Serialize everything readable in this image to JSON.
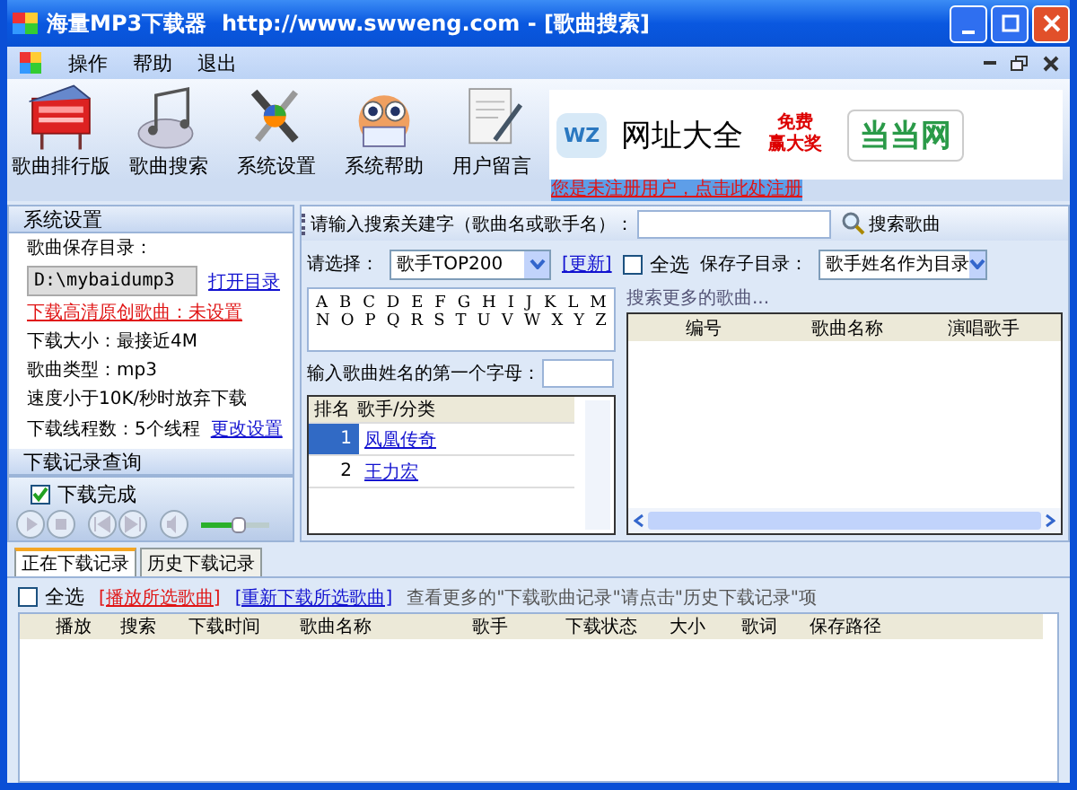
{
  "window": {
    "title": "海量MP3下载器  http://www.swweng.com - [歌曲搜索]"
  },
  "menu": {
    "items": [
      "操作",
      "帮助",
      "退出"
    ]
  },
  "toolbar": {
    "buttons": [
      {
        "label": "歌曲排行版",
        "kind": "board"
      },
      {
        "label": "歌曲搜索",
        "kind": "music"
      },
      {
        "label": "系统设置",
        "kind": "tools"
      },
      {
        "label": "系统帮助",
        "kind": "owl"
      },
      {
        "label": "用户留言",
        "kind": "note"
      }
    ]
  },
  "banner": {
    "logo": "WZ",
    "title": "网址大全",
    "promo": [
      "免费",
      "赢大奖"
    ],
    "brand": "当当网"
  },
  "register_link": "您是未注册用户，点击此处注册",
  "settings": {
    "header": "系统设置",
    "save_dir_label": "歌曲保存目录：",
    "save_dir_value": "D:\\mybaidump3",
    "open_dir_link": "打开目录",
    "hd_link": "下载高清原创歌曲：未设置",
    "lines": [
      "下载大小：最接近4M",
      "歌曲类型：mp3",
      "速度小于10K/秒时放弃下载"
    ],
    "threads": "下载线程数：5个线程",
    "change_link": "更改设置"
  },
  "history_header": "下载记录查询",
  "player": {
    "done": {
      "label": "下载完成",
      "checked": true
    },
    "volume": {
      "level": 0.55
    }
  },
  "search": {
    "label": "请输入搜索关建字（歌曲名或歌手名）：",
    "button": "搜索歌曲"
  },
  "filter": {
    "label": "请选择：",
    "dropdown": "歌手TOP200",
    "refresh_link": "[更新]",
    "select_all": {
      "label": "全选",
      "checked": false
    },
    "subdir_label": "保存子目录：",
    "subdir_dropdown": "歌手姓名作为目录"
  },
  "letters": [
    [
      "A",
      "B",
      "C",
      "D",
      "E",
      "F",
      "G",
      "H",
      "I",
      "J",
      "K",
      "L",
      "M"
    ],
    [
      "N",
      "O",
      "P",
      "Q",
      "R",
      "S",
      "T",
      "U",
      "V",
      "W",
      "X",
      "Y",
      "Z"
    ]
  ],
  "first_letter_label": "输入歌曲姓名的第一个字母：",
  "singer_table": {
    "columns": [
      "排名",
      "歌手/分类"
    ],
    "rows": [
      {
        "rank": "1",
        "name": "凤凰传奇",
        "selected": true
      },
      {
        "rank": "2",
        "name": "王力宏",
        "selected": false
      }
    ]
  },
  "more_songs": "搜索更多的歌曲...",
  "songs_table": {
    "columns": [
      "编号",
      "歌曲名称",
      "演唱歌手"
    ]
  },
  "tabs": [
    {
      "label": "正在下载记录",
      "selected": true
    },
    {
      "label": "历史下载记录",
      "selected": false
    }
  ],
  "downloads": {
    "select_all": {
      "label": "全选",
      "checked": false
    },
    "play_link": "[播放所选歌曲]",
    "redownload_link": "[重新下载所选歌曲]",
    "hint": "查看更多的\"下载歌曲记录\"请点击\"历史下载记录\"项",
    "columns": [
      "播放",
      "搜索",
      "下载时间",
      "歌曲名称",
      "歌手",
      "下载状态",
      "大小",
      "歌词",
      "保存路径"
    ]
  }
}
